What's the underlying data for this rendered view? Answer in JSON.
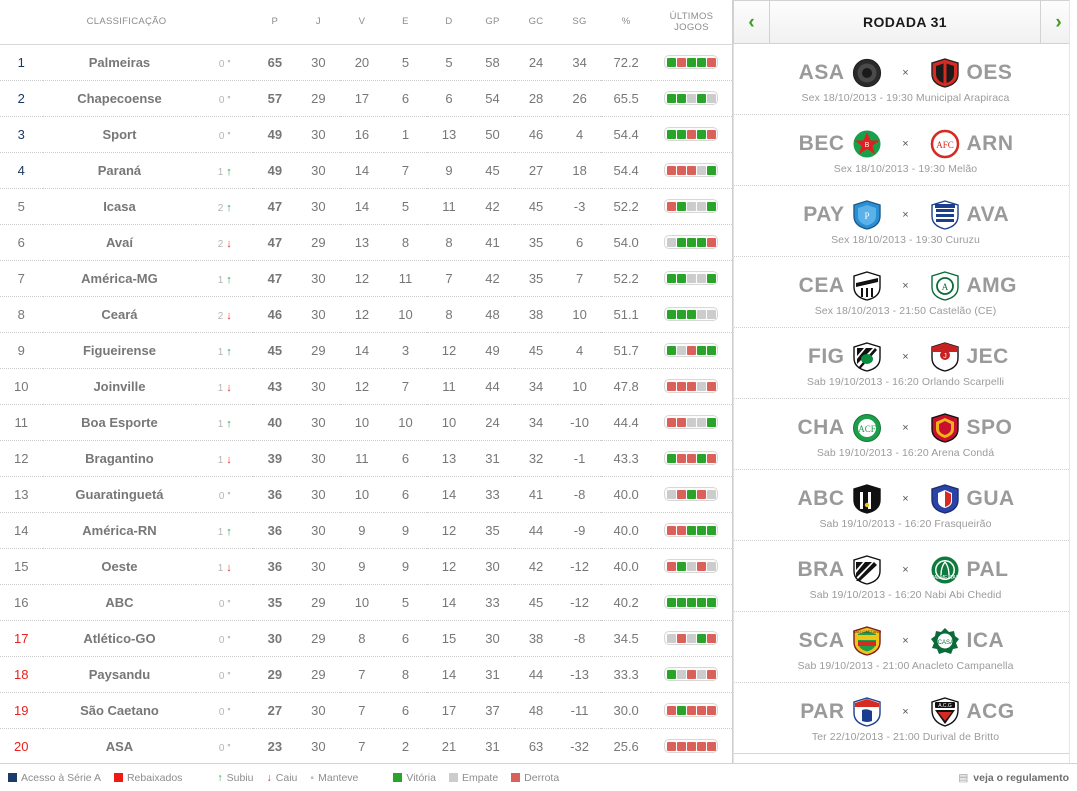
{
  "table": {
    "headers": {
      "classification": "CLASSIFICAÇÃO",
      "p": "P",
      "j": "J",
      "v": "V",
      "e": "E",
      "d": "D",
      "gp": "GP",
      "gc": "GC",
      "sg": "SG",
      "pct": "%",
      "form": "ÚLTIMOS JOGOS"
    },
    "rows": [
      {
        "pos": "1",
        "team": "Palmeiras",
        "zone": "promo",
        "mov": "0",
        "dir": "same",
        "p": "65",
        "j": "30",
        "v": "20",
        "e": "5",
        "d": "5",
        "gp": "58",
        "gc": "24",
        "sg": "34",
        "pct": "72.2",
        "form": [
          "V",
          "D",
          "V",
          "V",
          "D"
        ]
      },
      {
        "pos": "2",
        "team": "Chapecoense",
        "zone": "promo",
        "mov": "0",
        "dir": "same",
        "p": "57",
        "j": "29",
        "v": "17",
        "e": "6",
        "d": "6",
        "gp": "54",
        "gc": "28",
        "sg": "26",
        "pct": "65.5",
        "form": [
          "V",
          "V",
          "E",
          "V",
          "E"
        ]
      },
      {
        "pos": "3",
        "team": "Sport",
        "zone": "promo",
        "mov": "0",
        "dir": "same",
        "p": "49",
        "j": "30",
        "v": "16",
        "e": "1",
        "d": "13",
        "gp": "50",
        "gc": "46",
        "sg": "4",
        "pct": "54.4",
        "form": [
          "V",
          "V",
          "D",
          "V",
          "D"
        ]
      },
      {
        "pos": "4",
        "team": "Paraná",
        "zone": "promo",
        "mov": "1",
        "dir": "up",
        "p": "49",
        "j": "30",
        "v": "14",
        "e": "7",
        "d": "9",
        "gp": "45",
        "gc": "27",
        "sg": "18",
        "pct": "54.4",
        "form": [
          "D",
          "D",
          "D",
          "E",
          "V"
        ]
      },
      {
        "pos": "5",
        "team": "Icasa",
        "zone": "mid",
        "mov": "2",
        "dir": "up",
        "p": "47",
        "j": "30",
        "v": "14",
        "e": "5",
        "d": "11",
        "gp": "42",
        "gc": "45",
        "sg": "-3",
        "pct": "52.2",
        "form": [
          "D",
          "V",
          "E",
          "E",
          "V"
        ]
      },
      {
        "pos": "6",
        "team": "Avaí",
        "zone": "mid",
        "mov": "2",
        "dir": "down",
        "p": "47",
        "j": "29",
        "v": "13",
        "e": "8",
        "d": "8",
        "gp": "41",
        "gc": "35",
        "sg": "6",
        "pct": "54.0",
        "form": [
          "E",
          "V",
          "V",
          "V",
          "D"
        ]
      },
      {
        "pos": "7",
        "team": "América-MG",
        "zone": "mid",
        "mov": "1",
        "dir": "up",
        "p": "47",
        "j": "30",
        "v": "12",
        "e": "11",
        "d": "7",
        "gp": "42",
        "gc": "35",
        "sg": "7",
        "pct": "52.2",
        "form": [
          "V",
          "V",
          "E",
          "E",
          "V"
        ]
      },
      {
        "pos": "8",
        "team": "Ceará",
        "zone": "mid",
        "mov": "2",
        "dir": "down",
        "p": "46",
        "j": "30",
        "v": "12",
        "e": "10",
        "d": "8",
        "gp": "48",
        "gc": "38",
        "sg": "10",
        "pct": "51.1",
        "form": [
          "V",
          "V",
          "V",
          "E",
          "E"
        ]
      },
      {
        "pos": "9",
        "team": "Figueirense",
        "zone": "mid",
        "mov": "1",
        "dir": "up",
        "p": "45",
        "j": "29",
        "v": "14",
        "e": "3",
        "d": "12",
        "gp": "49",
        "gc": "45",
        "sg": "4",
        "pct": "51.7",
        "form": [
          "V",
          "E",
          "D",
          "V",
          "V"
        ]
      },
      {
        "pos": "10",
        "team": "Joinville",
        "zone": "mid",
        "mov": "1",
        "dir": "down",
        "p": "43",
        "j": "30",
        "v": "12",
        "e": "7",
        "d": "11",
        "gp": "44",
        "gc": "34",
        "sg": "10",
        "pct": "47.8",
        "form": [
          "D",
          "D",
          "D",
          "E",
          "D"
        ]
      },
      {
        "pos": "11",
        "team": "Boa Esporte",
        "zone": "mid",
        "mov": "1",
        "dir": "up",
        "p": "40",
        "j": "30",
        "v": "10",
        "e": "10",
        "d": "10",
        "gp": "24",
        "gc": "34",
        "sg": "-10",
        "pct": "44.4",
        "form": [
          "D",
          "D",
          "E",
          "E",
          "V"
        ]
      },
      {
        "pos": "12",
        "team": "Bragantino",
        "zone": "mid",
        "mov": "1",
        "dir": "down",
        "p": "39",
        "j": "30",
        "v": "11",
        "e": "6",
        "d": "13",
        "gp": "31",
        "gc": "32",
        "sg": "-1",
        "pct": "43.3",
        "form": [
          "V",
          "D",
          "D",
          "V",
          "D"
        ]
      },
      {
        "pos": "13",
        "team": "Guaratinguetá",
        "zone": "mid",
        "mov": "0",
        "dir": "same",
        "p": "36",
        "j": "30",
        "v": "10",
        "e": "6",
        "d": "14",
        "gp": "33",
        "gc": "41",
        "sg": "-8",
        "pct": "40.0",
        "form": [
          "E",
          "D",
          "V",
          "D",
          "E"
        ]
      },
      {
        "pos": "14",
        "team": "América-RN",
        "zone": "mid",
        "mov": "1",
        "dir": "up",
        "p": "36",
        "j": "30",
        "v": "9",
        "e": "9",
        "d": "12",
        "gp": "35",
        "gc": "44",
        "sg": "-9",
        "pct": "40.0",
        "form": [
          "D",
          "D",
          "V",
          "V",
          "V"
        ]
      },
      {
        "pos": "15",
        "team": "Oeste",
        "zone": "mid",
        "mov": "1",
        "dir": "down",
        "p": "36",
        "j": "30",
        "v": "9",
        "e": "9",
        "d": "12",
        "gp": "30",
        "gc": "42",
        "sg": "-12",
        "pct": "40.0",
        "form": [
          "D",
          "V",
          "E",
          "D",
          "E"
        ]
      },
      {
        "pos": "16",
        "team": "ABC",
        "zone": "mid",
        "mov": "0",
        "dir": "same",
        "p": "35",
        "j": "29",
        "v": "10",
        "e": "5",
        "d": "14",
        "gp": "33",
        "gc": "45",
        "sg": "-12",
        "pct": "40.2",
        "form": [
          "V",
          "V",
          "V",
          "V",
          "V"
        ]
      },
      {
        "pos": "17",
        "team": "Atlético-GO",
        "zone": "releg",
        "mov": "0",
        "dir": "same",
        "p": "30",
        "j": "29",
        "v": "8",
        "e": "6",
        "d": "15",
        "gp": "30",
        "gc": "38",
        "sg": "-8",
        "pct": "34.5",
        "form": [
          "E",
          "D",
          "E",
          "V",
          "D"
        ]
      },
      {
        "pos": "18",
        "team": "Paysandu",
        "zone": "releg",
        "mov": "0",
        "dir": "same",
        "p": "29",
        "j": "29",
        "v": "7",
        "e": "8",
        "d": "14",
        "gp": "31",
        "gc": "44",
        "sg": "-13",
        "pct": "33.3",
        "form": [
          "V",
          "E",
          "D",
          "E",
          "D"
        ]
      },
      {
        "pos": "19",
        "team": "São Caetano",
        "zone": "releg",
        "mov": "0",
        "dir": "same",
        "p": "27",
        "j": "30",
        "v": "7",
        "e": "6",
        "d": "17",
        "gp": "37",
        "gc": "48",
        "sg": "-11",
        "pct": "30.0",
        "form": [
          "D",
          "V",
          "D",
          "D",
          "D"
        ]
      },
      {
        "pos": "20",
        "team": "ASA",
        "zone": "releg",
        "mov": "0",
        "dir": "same",
        "p": "23",
        "j": "30",
        "v": "7",
        "e": "2",
        "d": "21",
        "gp": "31",
        "gc": "63",
        "sg": "-32",
        "pct": "25.6",
        "form": [
          "D",
          "D",
          "D",
          "D",
          "D"
        ]
      }
    ]
  },
  "fixtures": {
    "prev_label": "‹",
    "next_label": "›",
    "round_title": "RODADA 31",
    "vs_label": "×",
    "matches": [
      {
        "home": "ASA",
        "away": "OES",
        "home_crest": "asa",
        "away_crest": "oeste",
        "info": "Sex 18/10/2013 - 19:30 Municipal Arapiraca"
      },
      {
        "home": "BEC",
        "away": "ARN",
        "home_crest": "boa",
        "away_crest": "america-rn",
        "info": "Sex 18/10/2013 - 19:30 Melão"
      },
      {
        "home": "PAY",
        "away": "AVA",
        "home_crest": "paysandu",
        "away_crest": "avai",
        "info": "Sex 18/10/2013 - 19:30 Curuzu"
      },
      {
        "home": "CEA",
        "away": "AMG",
        "home_crest": "ceara",
        "away_crest": "america-mg",
        "info": "Sex 18/10/2013 - 21:50 Castelão (CE)"
      },
      {
        "home": "FIG",
        "away": "JEC",
        "home_crest": "figueirense",
        "away_crest": "joinville",
        "info": "Sab 19/10/2013 - 16:20 Orlando Scarpelli"
      },
      {
        "home": "CHA",
        "away": "SPO",
        "home_crest": "chapecoense",
        "away_crest": "sport",
        "info": "Sab 19/10/2013 - 16:20 Arena Condá"
      },
      {
        "home": "ABC",
        "away": "GUA",
        "home_crest": "abc",
        "away_crest": "guaratingueta",
        "info": "Sab 19/10/2013 - 16:20 Frasqueirão"
      },
      {
        "home": "BRA",
        "away": "PAL",
        "home_crest": "bragantino",
        "away_crest": "palmeiras",
        "info": "Sab 19/10/2013 - 16:20 Nabi Abi Chedid"
      },
      {
        "home": "SCA",
        "away": "ICA",
        "home_crest": "sao-caetano",
        "away_crest": "icasa",
        "info": "Sab 19/10/2013 - 21:00 Anacleto Campanella"
      },
      {
        "home": "PAR",
        "away": "ACG",
        "home_crest": "parana",
        "away_crest": "atletico-go",
        "info": "Ter 22/10/2013 - 21:00 Durival de Britto"
      }
    ]
  },
  "footer": {
    "legend": [
      {
        "type": "swatch",
        "color": "#1b3b6b",
        "label": "Acesso à Série A"
      },
      {
        "type": "swatch",
        "color": "#f01a14",
        "label": "Rebaixados"
      },
      {
        "type": "glyph",
        "glyph": "↑",
        "color": "#2e9e52",
        "label": "Subiu"
      },
      {
        "type": "glyph",
        "glyph": "↓",
        "color": "#e1332e",
        "label": "Caiu"
      },
      {
        "type": "glyph",
        "glyph": "▪",
        "color": "#c0c0c0",
        "label": "Manteve"
      },
      {
        "type": "swatch",
        "color": "#29a329",
        "label": "Vitória"
      },
      {
        "type": "swatch",
        "color": "#cccccc",
        "label": "Empate"
      },
      {
        "type": "swatch",
        "color": "#d9615a",
        "label": "Derrota"
      }
    ],
    "regulation_icon": "▤",
    "regulation_label": "veja o regulamento"
  },
  "colors": {
    "promo": "#17375e",
    "releg": "#e8211c",
    "win": "#29a329",
    "draw": "#cccccc",
    "loss": "#d9615a",
    "accent_green": "#3d9e22"
  }
}
